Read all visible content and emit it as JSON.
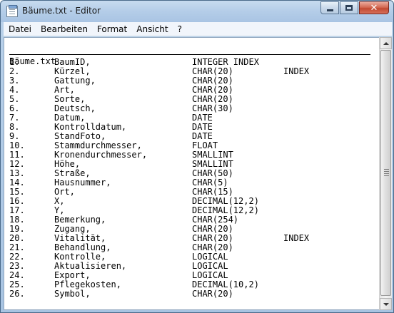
{
  "window": {
    "title": "Bäume.txt - Editor",
    "icon": "notepad-icon",
    "buttons": {
      "minimize": "minimize-icon",
      "maximize": "maximize-icon",
      "close_glyph": "✕"
    }
  },
  "menu": {
    "items": [
      "Datei",
      "Bearbeiten",
      "Format",
      "Ansicht",
      "?"
    ]
  },
  "document": {
    "header": "Bäume.txt",
    "rows": [
      {
        "num": "1.",
        "name": "BaumID,",
        "type": "INTEGER INDEX",
        "index": ""
      },
      {
        "num": "2.",
        "name": "Kürzel,",
        "type": "CHAR(20)",
        "index": "INDEX"
      },
      {
        "num": "3.",
        "name": "Gattung,",
        "type": "CHAR(20)",
        "index": ""
      },
      {
        "num": "4.",
        "name": "Art,",
        "type": "CHAR(20)",
        "index": ""
      },
      {
        "num": "5.",
        "name": "Sorte,",
        "type": "CHAR(20)",
        "index": ""
      },
      {
        "num": "6.",
        "name": "Deutsch,",
        "type": "CHAR(30)",
        "index": ""
      },
      {
        "num": "7.",
        "name": "Datum,",
        "type": "DATE",
        "index": ""
      },
      {
        "num": "8.",
        "name": "Kontrolldatum,",
        "type": "DATE",
        "index": ""
      },
      {
        "num": "9.",
        "name": "StandFoto,",
        "type": "DATE",
        "index": ""
      },
      {
        "num": "10.",
        "name": "Stammdurchmesser,",
        "type": "FLOAT",
        "index": ""
      },
      {
        "num": "11.",
        "name": "Kronendurchmesser,",
        "type": "SMALLINT",
        "index": ""
      },
      {
        "num": "12.",
        "name": "Höhe,",
        "type": "SMALLINT",
        "index": ""
      },
      {
        "num": "13.",
        "name": "Straße,",
        "type": "CHAR(50)",
        "index": ""
      },
      {
        "num": "14.",
        "name": "Hausnummer,",
        "type": "CHAR(5)",
        "index": ""
      },
      {
        "num": "15.",
        "name": "Ort,",
        "type": "CHAR(15)",
        "index": ""
      },
      {
        "num": "16.",
        "name": "X,",
        "type": "DECIMAL(12,2)",
        "index": ""
      },
      {
        "num": "17.",
        "name": "Y,",
        "type": "DECIMAL(12,2)",
        "index": ""
      },
      {
        "num": "18.",
        "name": "Bemerkung,",
        "type": "CHAR(254)",
        "index": ""
      },
      {
        "num": "19.",
        "name": "Zugang,",
        "type": "CHAR(20)",
        "index": ""
      },
      {
        "num": "20.",
        "name": "Vitalität,",
        "type": "CHAR(20)",
        "index": "INDEX"
      },
      {
        "num": "21.",
        "name": "Behandlung,",
        "type": "CHAR(20)",
        "index": ""
      },
      {
        "num": "22.",
        "name": "Kontrolle,",
        "type": "LOGICAL",
        "index": ""
      },
      {
        "num": "23.",
        "name": "Aktualisieren,",
        "type": "LOGICAL",
        "index": ""
      },
      {
        "num": "24.",
        "name": "Export,",
        "type": "LOGICAL",
        "index": ""
      },
      {
        "num": "25.",
        "name": "Pflegekosten,",
        "type": "DECIMAL(10,2)",
        "index": ""
      },
      {
        "num": "26.",
        "name": "Symbol,",
        "type": "CHAR(20)",
        "index": ""
      }
    ]
  },
  "scrollbar": {
    "up_icon": "scroll-up-arrow-icon",
    "down_icon": "scroll-down-arrow-icon"
  }
}
